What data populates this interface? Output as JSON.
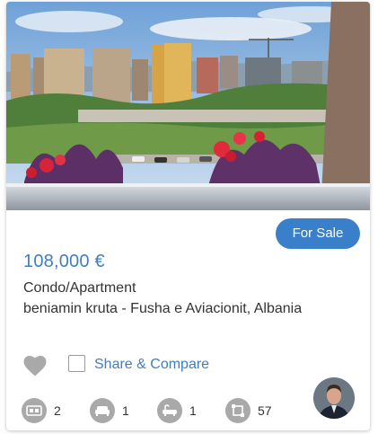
{
  "listing": {
    "status_badge": "For Sale",
    "price": "108,000 €",
    "property_type": "Condo/Apartment",
    "location": "beniamin kruta - Fusha e Aviacionit, Albania",
    "compare_label": "Share & Compare",
    "features": [
      {
        "icon": "bed-icon",
        "value": "2"
      },
      {
        "icon": "sofa-icon",
        "value": "1"
      },
      {
        "icon": "bathtub-icon",
        "value": "1"
      },
      {
        "icon": "area-icon",
        "value": "57"
      }
    ]
  },
  "colors": {
    "accent": "#3a7fc9",
    "link": "#3f7ec2",
    "icon_gray": "#a9a9a9",
    "text": "#333333"
  }
}
